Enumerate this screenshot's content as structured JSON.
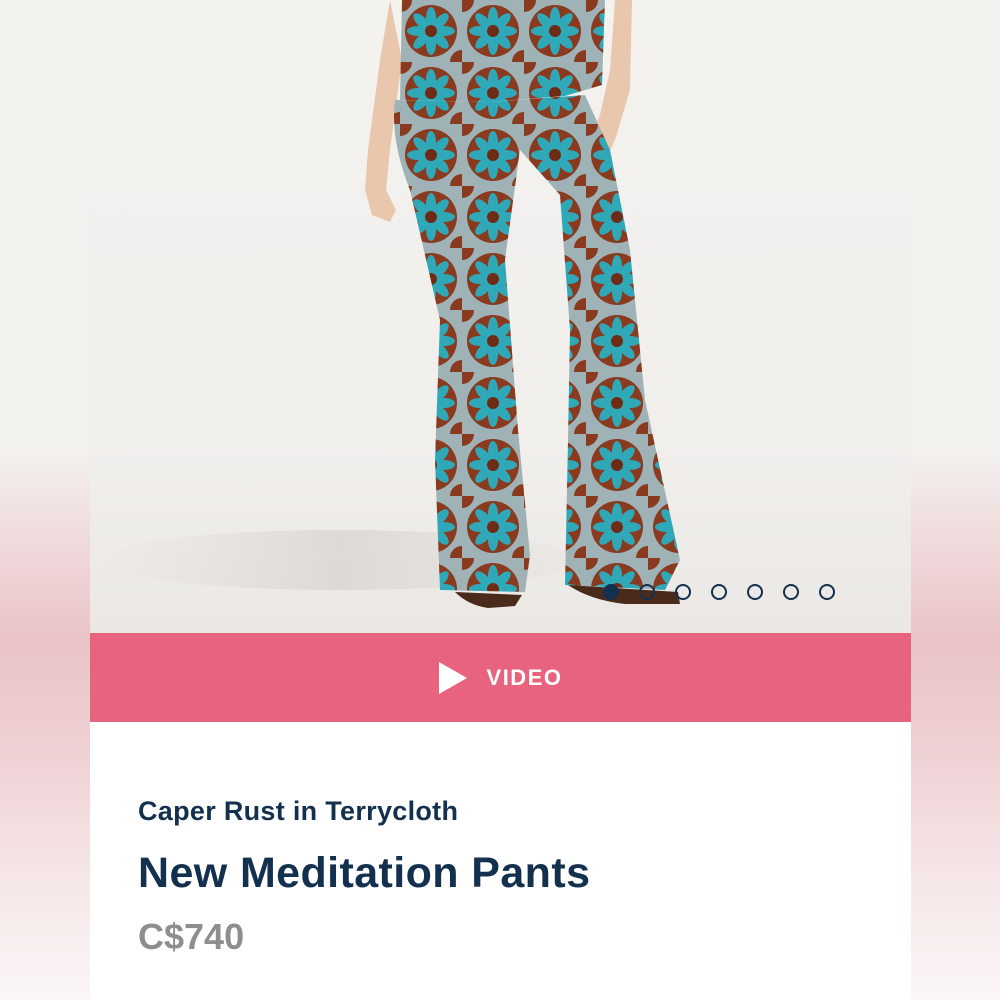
{
  "product": {
    "collection": "Caper Rust in Terrycloth",
    "name": "New Meditation Pants",
    "price": "C$740"
  },
  "gallery": {
    "image_icon": "product-photo",
    "dot_count": 7,
    "active_index": 0
  },
  "video_button": {
    "label": "VIDEO",
    "icon": "play-icon"
  },
  "colors": {
    "accent_pink": "#e8637e",
    "navy_text": "#13314e",
    "price_gray": "#8e8e8e",
    "fabric_rust": "#8a3a1f",
    "fabric_teal": "#2fa8b8"
  }
}
